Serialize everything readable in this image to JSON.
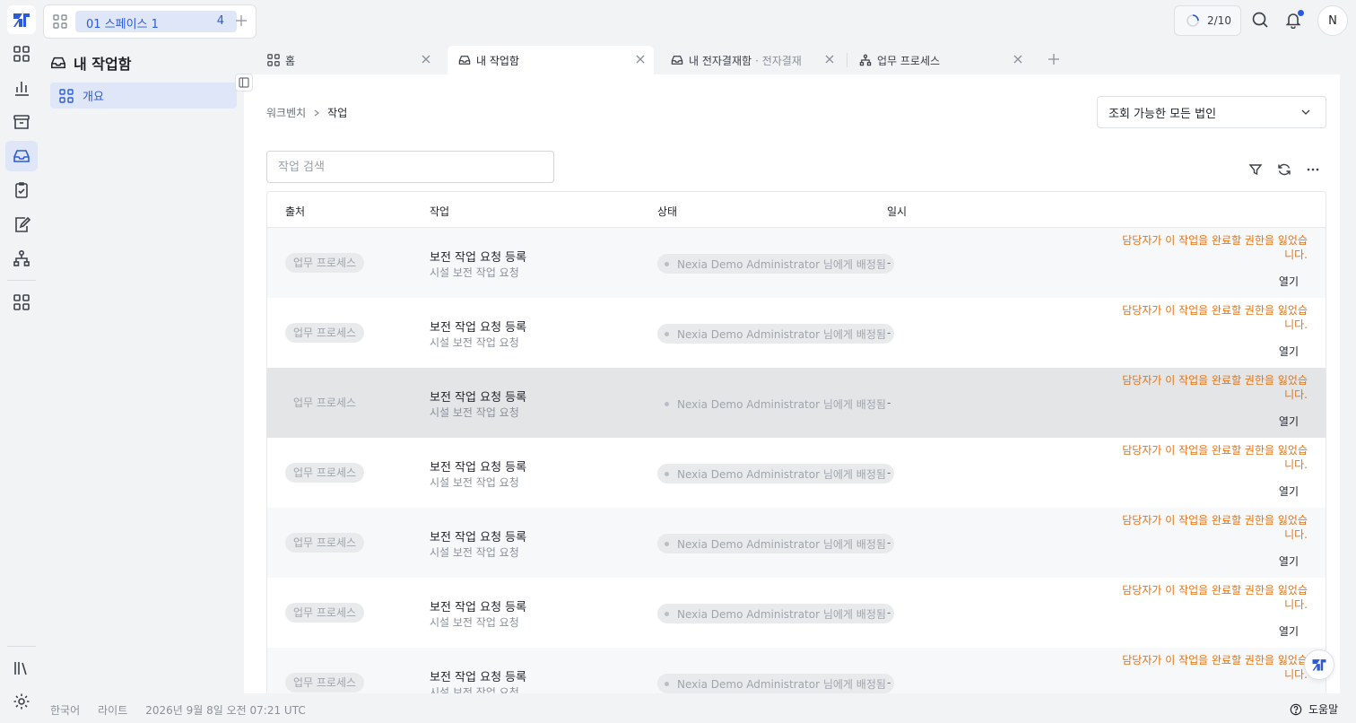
{
  "colors": {
    "accent": "#2c5bd9",
    "warning": "#e8730f",
    "active_bg": "#dfe6f8"
  },
  "rail": {
    "logo": "app-logo",
    "items": [
      "apps-icon",
      "chart-icon",
      "archive-icon",
      "inbox-icon",
      "task-check-icon",
      "approval-icon",
      "process-icon",
      "grid-icon"
    ],
    "active": "inbox-icon",
    "bottom": [
      "library-icon",
      "settings-icon"
    ]
  },
  "space": {
    "name": "01 스페이스 1",
    "count": "4"
  },
  "topbar": {
    "progress": "2/10"
  },
  "user": {
    "initial": "N"
  },
  "sidebar": {
    "title": "내 작업함",
    "items": [
      {
        "label": "개요"
      }
    ]
  },
  "tabs": [
    {
      "label": "홈",
      "sub": ""
    },
    {
      "label": "내 작업함",
      "sub": ""
    },
    {
      "label": "내 전자결재함",
      "sub": "· 전자결재"
    },
    {
      "label": "업무 프로세스",
      "sub": ""
    }
  ],
  "breadcrumb": {
    "root": "워크벤치",
    "current": "작업"
  },
  "entity_select": {
    "value": "조회 가능한 모든 법인"
  },
  "search": {
    "placeholder": "작업 검색",
    "value": ""
  },
  "table": {
    "columns": [
      "출처",
      "작업",
      "상태",
      "일시"
    ],
    "rows": [
      {
        "source": "업무 프로세스",
        "title": "보전 작업 요청 등록",
        "subtitle": "시설 보전 작업 요청",
        "status": "Nexia Demo Administrator 님에게 배정됨",
        "date": "-",
        "warning": "담당자가 이 작업을 완료할 권한을 잃었습니다.",
        "action": "열기"
      },
      {
        "source": "업무 프로세스",
        "title": "보전 작업 요청 등록",
        "subtitle": "시설 보전 작업 요청",
        "status": "Nexia Demo Administrator 님에게 배정됨",
        "date": "-",
        "warning": "담당자가 이 작업을 완료할 권한을 잃었습니다.",
        "action": "열기"
      },
      {
        "source": "업무 프로세스",
        "title": "보전 작업 요청 등록",
        "subtitle": "시설 보전 작업 요청",
        "status": "Nexia Demo Administrator 님에게 배정됨",
        "date": "-",
        "warning": "담당자가 이 작업을 완료할 권한을 잃었습니다.",
        "action": "열기"
      },
      {
        "source": "업무 프로세스",
        "title": "보전 작업 요청 등록",
        "subtitle": "시설 보전 작업 요청",
        "status": "Nexia Demo Administrator 님에게 배정됨",
        "date": "-",
        "warning": "담당자가 이 작업을 완료할 권한을 잃었습니다.",
        "action": "열기"
      },
      {
        "source": "업무 프로세스",
        "title": "보전 작업 요청 등록",
        "subtitle": "시설 보전 작업 요청",
        "status": "Nexia Demo Administrator 님에게 배정됨",
        "date": "-",
        "warning": "담당자가 이 작업을 완료할 권한을 잃었습니다.",
        "action": "열기"
      },
      {
        "source": "업무 프로세스",
        "title": "보전 작업 요청 등록",
        "subtitle": "시설 보전 작업 요청",
        "status": "Nexia Demo Administrator 님에게 배정됨",
        "date": "-",
        "warning": "담당자가 이 작업을 완료할 권한을 잃었습니다.",
        "action": "열기"
      },
      {
        "source": "업무 프로세스",
        "title": "보전 작업 요청 등록",
        "subtitle": "시설 보전 작업 요청",
        "status": "Nexia Demo Administrator 님에게 배정됨",
        "date": "-",
        "warning": "담당자가 이 작업을 완료할 권한을 잃었습니다.",
        "action": ""
      }
    ]
  },
  "footer": {
    "language": "한국어",
    "theme": "라이트",
    "datetime": "2026년 9월 8일 오전 07:21 UTC",
    "help": "도움말"
  }
}
